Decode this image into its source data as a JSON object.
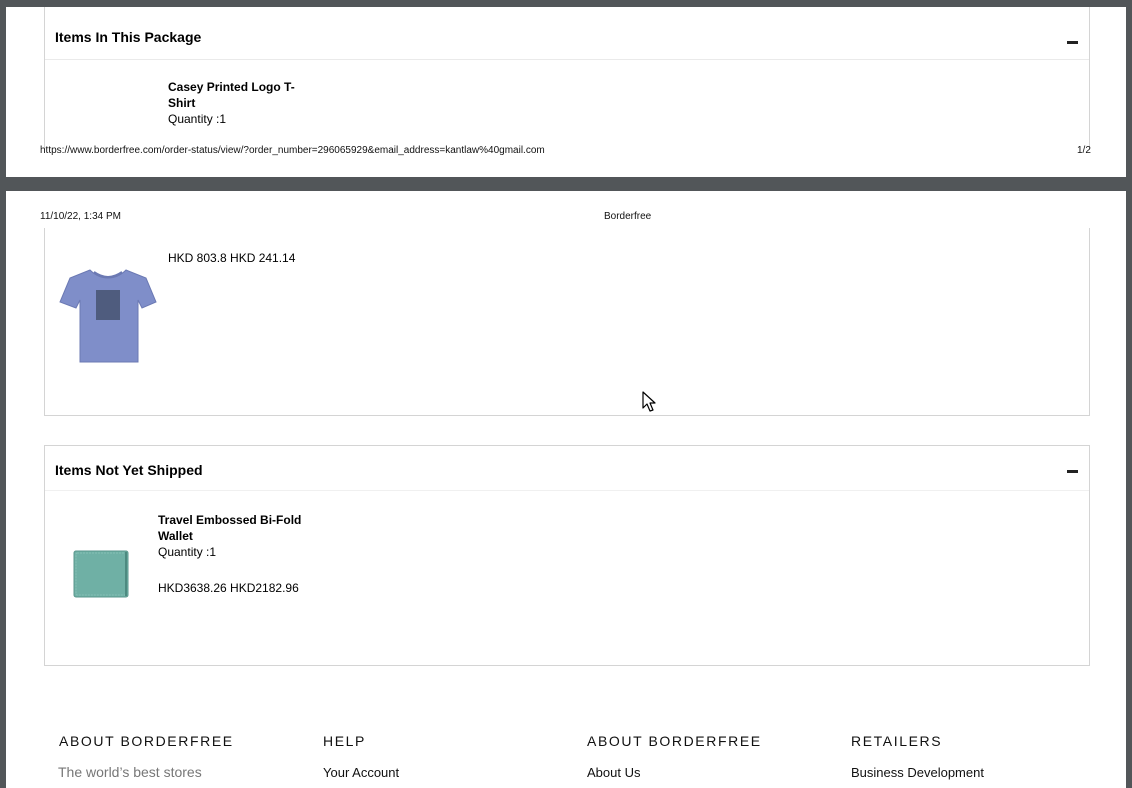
{
  "page1": {
    "section_title": "Items In This Package",
    "item": {
      "name_line1": "Casey Printed Logo T-",
      "name_line2": "Shirt",
      "quantity": "Quantity :1"
    },
    "footer_url": "https://www.borderfree.com/order-status/view/?order_number=296065929&email_address=kantlaw%40gmail.com",
    "page_number": "1/2"
  },
  "page2": {
    "header_datetime": "11/10/22, 1:34 PM",
    "header_title": "Borderfree",
    "package_item_price": "HKD 803.8 HKD 241.14",
    "not_shipped": {
      "section_title": "Items Not Yet Shipped",
      "item": {
        "name_line1": "Travel Embossed Bi-Fold",
        "name_line2": "Wallet",
        "quantity": "Quantity :1",
        "price": "HKD3638.26 HKD2182.96"
      }
    },
    "footer": {
      "col1": {
        "heading": "ABOUT BORDERFREE",
        "text": "The world’s best stores"
      },
      "col2": {
        "heading": "HELP",
        "link": "Your Account"
      },
      "col3": {
        "heading": "ABOUT BORDERFREE",
        "link": "About Us"
      },
      "col4": {
        "heading": "RETAILERS",
        "link": "Business Development"
      }
    }
  },
  "colors": {
    "viewer_bg": "#525659",
    "tshirt": "#7f8ec9",
    "wallet": "#6fb0a5"
  }
}
